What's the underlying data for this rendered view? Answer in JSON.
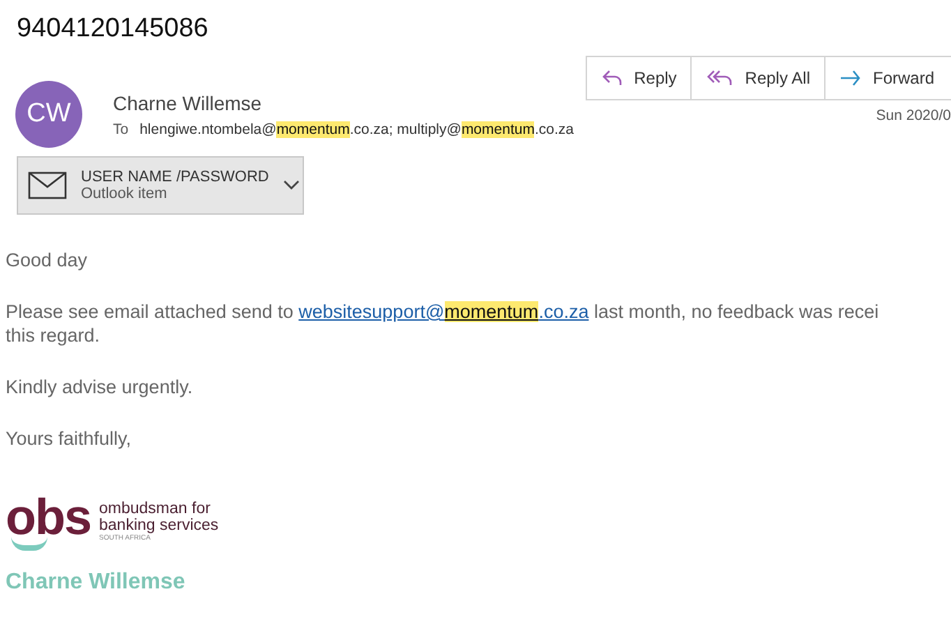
{
  "subject": "9404120145086",
  "actions": [
    {
      "kind": "reply",
      "label": "Reply"
    },
    {
      "kind": "reply_all",
      "label": "Reply All"
    },
    {
      "kind": "forward",
      "label": "Forward"
    }
  ],
  "sender": {
    "initials": "CW",
    "name": "Charne Willemse"
  },
  "to_label": "To",
  "recipients": [
    {
      "text": "hlengiwe.ntombela@",
      "highlight": false
    },
    {
      "text": "momentum",
      "highlight": true
    },
    {
      "text": ".co.za; multiply@",
      "highlight": false
    },
    {
      "text": "momentum",
      "highlight": true
    },
    {
      "text": ".co.za",
      "highlight": false
    }
  ],
  "date": "Sun 2020/0",
  "attachment": {
    "name": "USER NAME /PASSWORD",
    "type": "Outlook item"
  },
  "body": [
    {
      "kind": "text",
      "lines": [
        [
          {
            "text": "Good day"
          }
        ]
      ]
    },
    {
      "kind": "text",
      "lines": [
        [
          {
            "text": "Please see email attached send to "
          },
          {
            "text": "websitesupport@",
            "link": true
          },
          {
            "text": "momentum",
            "link": true,
            "highlight": true
          },
          {
            "text": ".co.za",
            "link": true
          },
          {
            "text": " last month, no feedback was recei"
          }
        ],
        [
          {
            "text": "this regard."
          }
        ]
      ]
    },
    {
      "kind": "text",
      "lines": [
        [
          {
            "text": "Kindly advise urgently."
          }
        ]
      ]
    },
    {
      "kind": "text",
      "lines": [
        [
          {
            "text": "Yours faithfully,"
          }
        ]
      ]
    }
  ],
  "signature": {
    "logo_mark": "obs",
    "logo_lines": [
      "ombudsman for",
      "banking services"
    ],
    "logo_country": "SOUTH AFRICA",
    "name": "Charne Willemse"
  }
}
